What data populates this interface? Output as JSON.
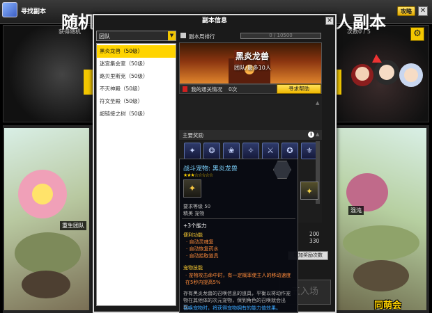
{
  "window": {
    "title": "寻找副本",
    "guide_label": "攻略",
    "close_label": "✕"
  },
  "banner": {
    "left_title": "随机",
    "left_sub": "获得随机",
    "right_title": "人副本",
    "right_count": "次数0 / 5",
    "gear": "⚙"
  },
  "map": {
    "heroes_label": "重生团队",
    "chaos_label": "混沌",
    "watermark": "同萌会"
  },
  "dialog": {
    "title": "副本信息",
    "close_label": "✕",
    "filter_value": "团队",
    "filter_arrow": "▼",
    "dungeons": [
      "黑炎龙兽（50级）",
      "迷宫集会室（50级）",
      "路贝里斯克（50级）",
      "不灭神殿（50级）",
      "符文圣殿（50级）",
      "超链接之树（50级）"
    ],
    "rank_label": "副本周排行",
    "rank_value": "0 / 10500",
    "boss_name": "黑炎龙兽",
    "boss_mode": "团队/最多10人",
    "clear_label": "我的通关情况",
    "clear_count": "0次",
    "help_button": "寻求帮助",
    "reward_label": "主要奖励",
    "rewards": [
      "✦",
      "❂",
      "❀",
      "✧",
      "⚔",
      "✪",
      "⚜"
    ],
    "bonus_button": "增加奖励次数",
    "enter_button": "五入场",
    "right_nums": [
      "200",
      "330"
    ]
  },
  "tooltip": {
    "title": "战斗宠物: 黑炎龙兽",
    "stars": "★★★☆☆☆☆☆",
    "item_icon": "✦",
    "req_level": "要求等级 50",
    "bind": "精美 宠物",
    "abilities": "+3个能力",
    "util_label": "便利功能",
    "util_lines": [
      "· 自动灵魂复",
      "· 自动恢复药水",
      "· 自动拾取道具"
    ],
    "skill_label": "宠物技能",
    "skill_desc": "· 宠物攻击命中时，有一定概率使主人的移动速度在5秒内提高5%",
    "desc1": "存有黑炎龙兽的召唤信息的道具，平衡以将动作宠物在其他体的次元宠物，保到角色的召唤就会出现。",
    "desc2": "召唤宠物时，将获得宠物拥有的能力值效果。"
  }
}
